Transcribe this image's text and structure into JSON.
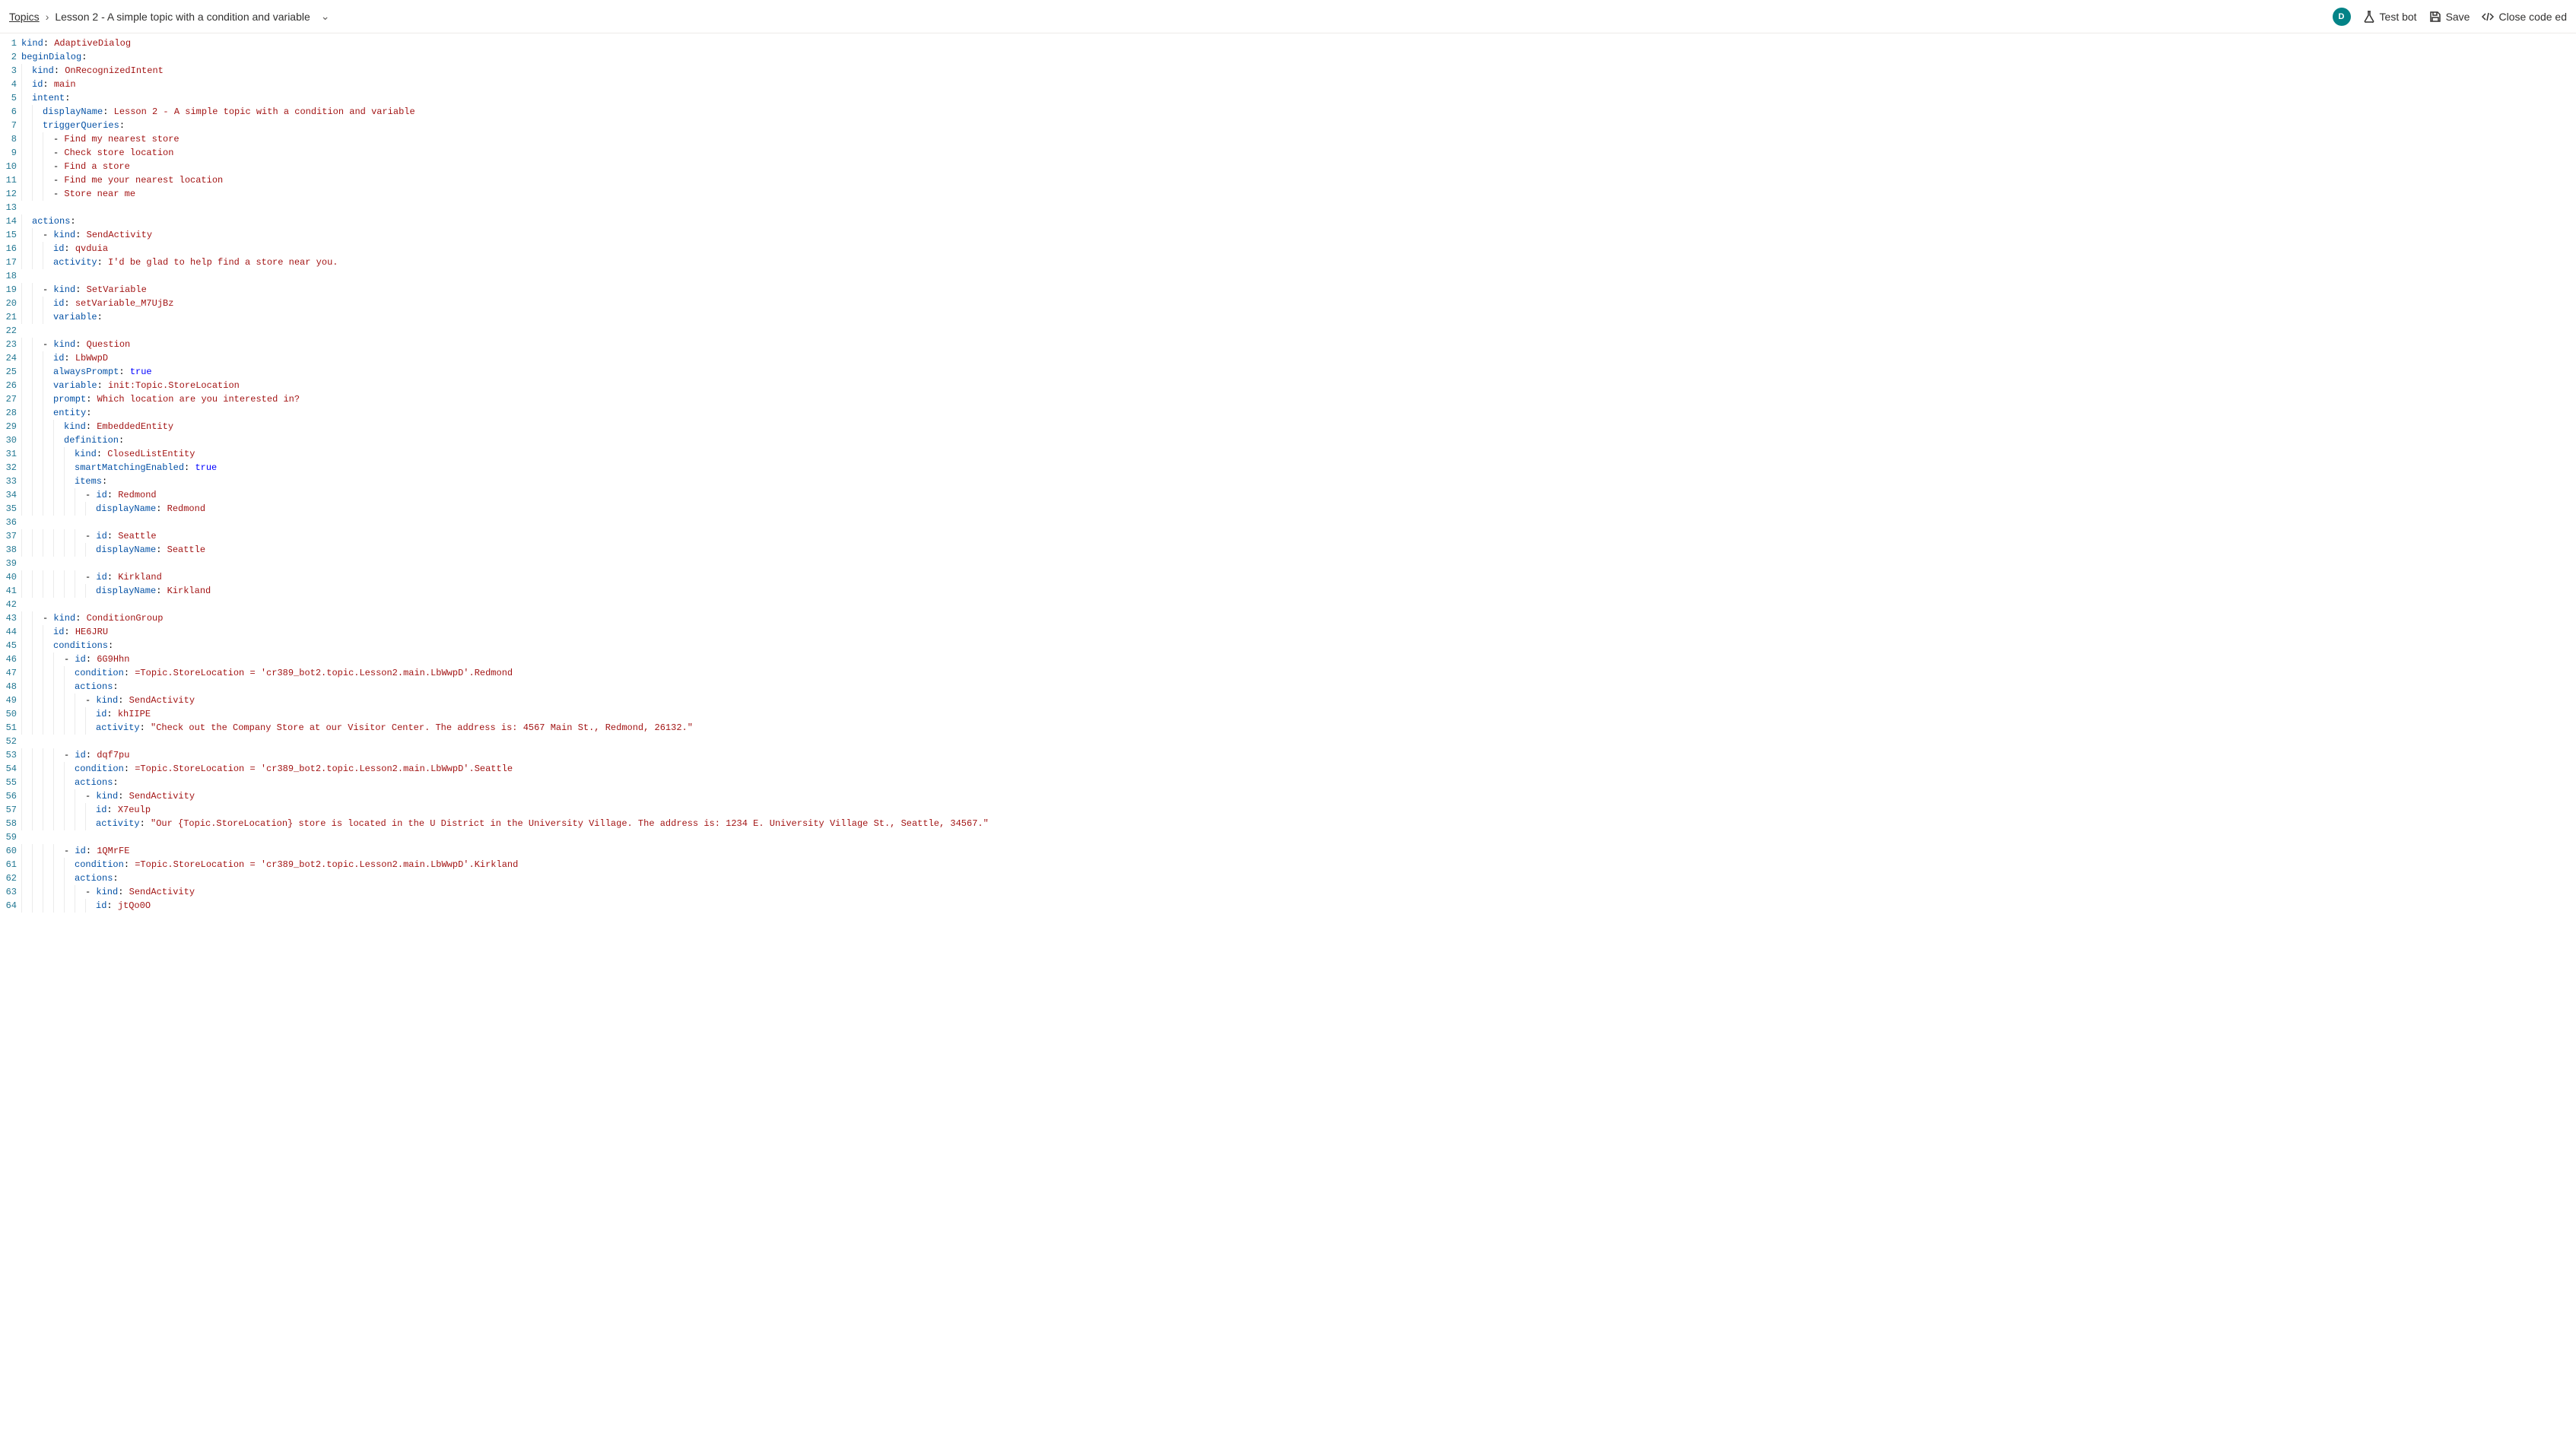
{
  "header": {
    "breadcrumb_root": "Topics",
    "breadcrumb_title": "Lesson 2 - A simple topic with a condition and variable",
    "avatar_letter": "D",
    "test_bot": "Test bot",
    "save": "Save",
    "close_code": "Close code ed"
  },
  "code": {
    "lines": [
      {
        "indent": 0,
        "segs": [
          [
            "key",
            "kind"
          ],
          [
            "punct",
            ": "
          ],
          [
            "str",
            "AdaptiveDialog"
          ]
        ]
      },
      {
        "indent": 0,
        "segs": [
          [
            "key",
            "beginDialog"
          ],
          [
            "punct",
            ":"
          ]
        ]
      },
      {
        "indent": 1,
        "segs": [
          [
            "key",
            "kind"
          ],
          [
            "punct",
            ": "
          ],
          [
            "str",
            "OnRecognizedIntent"
          ]
        ]
      },
      {
        "indent": 1,
        "segs": [
          [
            "key",
            "id"
          ],
          [
            "punct",
            ": "
          ],
          [
            "str",
            "main"
          ]
        ]
      },
      {
        "indent": 1,
        "segs": [
          [
            "key",
            "intent"
          ],
          [
            "punct",
            ":"
          ]
        ]
      },
      {
        "indent": 2,
        "segs": [
          [
            "key",
            "displayName"
          ],
          [
            "punct",
            ": "
          ],
          [
            "str",
            "Lesson 2 - A simple topic with a condition and variable"
          ]
        ]
      },
      {
        "indent": 2,
        "segs": [
          [
            "key",
            "triggerQueries"
          ],
          [
            "punct",
            ":"
          ]
        ]
      },
      {
        "indent": 3,
        "segs": [
          [
            "punct",
            "- "
          ],
          [
            "str",
            "Find my nearest store"
          ]
        ]
      },
      {
        "indent": 3,
        "segs": [
          [
            "punct",
            "- "
          ],
          [
            "str",
            "Check store location"
          ]
        ]
      },
      {
        "indent": 3,
        "segs": [
          [
            "punct",
            "- "
          ],
          [
            "str",
            "Find a store"
          ]
        ]
      },
      {
        "indent": 3,
        "segs": [
          [
            "punct",
            "- "
          ],
          [
            "str",
            "Find me your nearest location"
          ]
        ]
      },
      {
        "indent": 3,
        "segs": [
          [
            "punct",
            "- "
          ],
          [
            "str",
            "Store near me"
          ]
        ]
      },
      {
        "indent": 0,
        "segs": []
      },
      {
        "indent": 1,
        "segs": [
          [
            "key",
            "actions"
          ],
          [
            "punct",
            ":"
          ]
        ]
      },
      {
        "indent": 2,
        "segs": [
          [
            "punct",
            "- "
          ],
          [
            "key",
            "kind"
          ],
          [
            "punct",
            ": "
          ],
          [
            "str",
            "SendActivity"
          ]
        ]
      },
      {
        "indent": 3,
        "segs": [
          [
            "key",
            "id"
          ],
          [
            "punct",
            ": "
          ],
          [
            "str",
            "qvduia"
          ]
        ]
      },
      {
        "indent": 3,
        "segs": [
          [
            "key",
            "activity"
          ],
          [
            "punct",
            ": "
          ],
          [
            "str",
            "I'd be glad to help find a store near you."
          ]
        ]
      },
      {
        "indent": 0,
        "segs": []
      },
      {
        "indent": 2,
        "segs": [
          [
            "punct",
            "- "
          ],
          [
            "key",
            "kind"
          ],
          [
            "punct",
            ": "
          ],
          [
            "str",
            "SetVariable"
          ]
        ]
      },
      {
        "indent": 3,
        "segs": [
          [
            "key",
            "id"
          ],
          [
            "punct",
            ": "
          ],
          [
            "str",
            "setVariable_M7UjBz"
          ]
        ]
      },
      {
        "indent": 3,
        "segs": [
          [
            "key",
            "variable"
          ],
          [
            "punct",
            ":"
          ]
        ]
      },
      {
        "indent": 0,
        "segs": []
      },
      {
        "indent": 2,
        "segs": [
          [
            "punct",
            "- "
          ],
          [
            "key",
            "kind"
          ],
          [
            "punct",
            ": "
          ],
          [
            "str",
            "Question"
          ]
        ]
      },
      {
        "indent": 3,
        "segs": [
          [
            "key",
            "id"
          ],
          [
            "punct",
            ": "
          ],
          [
            "str",
            "LbWwpD"
          ]
        ]
      },
      {
        "indent": 3,
        "segs": [
          [
            "key",
            "alwaysPrompt"
          ],
          [
            "punct",
            ": "
          ],
          [
            "bool",
            "true"
          ]
        ]
      },
      {
        "indent": 3,
        "segs": [
          [
            "key",
            "variable"
          ],
          [
            "punct",
            ": "
          ],
          [
            "str",
            "init:Topic.StoreLocation"
          ]
        ]
      },
      {
        "indent": 3,
        "segs": [
          [
            "key",
            "prompt"
          ],
          [
            "punct",
            ": "
          ],
          [
            "str",
            "Which location are you interested in?"
          ]
        ]
      },
      {
        "indent": 3,
        "segs": [
          [
            "key",
            "entity"
          ],
          [
            "punct",
            ":"
          ]
        ]
      },
      {
        "indent": 4,
        "segs": [
          [
            "key",
            "kind"
          ],
          [
            "punct",
            ": "
          ],
          [
            "str",
            "EmbeddedEntity"
          ]
        ]
      },
      {
        "indent": 4,
        "segs": [
          [
            "key",
            "definition"
          ],
          [
            "punct",
            ":"
          ]
        ]
      },
      {
        "indent": 5,
        "segs": [
          [
            "key",
            "kind"
          ],
          [
            "punct",
            ": "
          ],
          [
            "str",
            "ClosedListEntity"
          ]
        ]
      },
      {
        "indent": 5,
        "segs": [
          [
            "key",
            "smartMatchingEnabled"
          ],
          [
            "punct",
            ": "
          ],
          [
            "bool",
            "true"
          ]
        ]
      },
      {
        "indent": 5,
        "segs": [
          [
            "key",
            "items"
          ],
          [
            "punct",
            ":"
          ]
        ]
      },
      {
        "indent": 6,
        "segs": [
          [
            "punct",
            "- "
          ],
          [
            "key",
            "id"
          ],
          [
            "punct",
            ": "
          ],
          [
            "str",
            "Redmond"
          ]
        ]
      },
      {
        "indent": 7,
        "segs": [
          [
            "key",
            "displayName"
          ],
          [
            "punct",
            ": "
          ],
          [
            "str",
            "Redmond"
          ]
        ]
      },
      {
        "indent": 0,
        "segs": []
      },
      {
        "indent": 6,
        "segs": [
          [
            "punct",
            "- "
          ],
          [
            "key",
            "id"
          ],
          [
            "punct",
            ": "
          ],
          [
            "str",
            "Seattle"
          ]
        ]
      },
      {
        "indent": 7,
        "segs": [
          [
            "key",
            "displayName"
          ],
          [
            "punct",
            ": "
          ],
          [
            "str",
            "Seattle"
          ]
        ]
      },
      {
        "indent": 0,
        "segs": []
      },
      {
        "indent": 6,
        "segs": [
          [
            "punct",
            "- "
          ],
          [
            "key",
            "id"
          ],
          [
            "punct",
            ": "
          ],
          [
            "str",
            "Kirkland"
          ]
        ]
      },
      {
        "indent": 7,
        "segs": [
          [
            "key",
            "displayName"
          ],
          [
            "punct",
            ": "
          ],
          [
            "str",
            "Kirkland"
          ]
        ]
      },
      {
        "indent": 0,
        "segs": []
      },
      {
        "indent": 2,
        "segs": [
          [
            "punct",
            "- "
          ],
          [
            "key",
            "kind"
          ],
          [
            "punct",
            ": "
          ],
          [
            "str",
            "ConditionGroup"
          ]
        ]
      },
      {
        "indent": 3,
        "segs": [
          [
            "key",
            "id"
          ],
          [
            "punct",
            ": "
          ],
          [
            "str",
            "HE6JRU"
          ]
        ]
      },
      {
        "indent": 3,
        "segs": [
          [
            "key",
            "conditions"
          ],
          [
            "punct",
            ":"
          ]
        ]
      },
      {
        "indent": 4,
        "segs": [
          [
            "punct",
            "- "
          ],
          [
            "key",
            "id"
          ],
          [
            "punct",
            ": "
          ],
          [
            "str",
            "6G9Hhn"
          ]
        ]
      },
      {
        "indent": 5,
        "segs": [
          [
            "key",
            "condition"
          ],
          [
            "punct",
            ": "
          ],
          [
            "str",
            "=Topic.StoreLocation = 'cr389_bot2.topic.Lesson2.main.LbWwpD'.Redmond"
          ]
        ]
      },
      {
        "indent": 5,
        "segs": [
          [
            "key",
            "actions"
          ],
          [
            "punct",
            ":"
          ]
        ]
      },
      {
        "indent": 6,
        "segs": [
          [
            "punct",
            "- "
          ],
          [
            "key",
            "kind"
          ],
          [
            "punct",
            ": "
          ],
          [
            "str",
            "SendActivity"
          ]
        ]
      },
      {
        "indent": 7,
        "segs": [
          [
            "key",
            "id"
          ],
          [
            "punct",
            ": "
          ],
          [
            "str",
            "khIIPE"
          ]
        ]
      },
      {
        "indent": 7,
        "segs": [
          [
            "key",
            "activity"
          ],
          [
            "punct",
            ": "
          ],
          [
            "str",
            "\"Check out the Company Store at our Visitor Center. The address is: 4567 Main St., Redmond, 26132.\""
          ]
        ]
      },
      {
        "indent": 0,
        "segs": []
      },
      {
        "indent": 4,
        "segs": [
          [
            "punct",
            "- "
          ],
          [
            "key",
            "id"
          ],
          [
            "punct",
            ": "
          ],
          [
            "str",
            "dqf7pu"
          ]
        ]
      },
      {
        "indent": 5,
        "segs": [
          [
            "key",
            "condition"
          ],
          [
            "punct",
            ": "
          ],
          [
            "str",
            "=Topic.StoreLocation = 'cr389_bot2.topic.Lesson2.main.LbWwpD'.Seattle"
          ]
        ]
      },
      {
        "indent": 5,
        "segs": [
          [
            "key",
            "actions"
          ],
          [
            "punct",
            ":"
          ]
        ]
      },
      {
        "indent": 6,
        "segs": [
          [
            "punct",
            "- "
          ],
          [
            "key",
            "kind"
          ],
          [
            "punct",
            ": "
          ],
          [
            "str",
            "SendActivity"
          ]
        ]
      },
      {
        "indent": 7,
        "segs": [
          [
            "key",
            "id"
          ],
          [
            "punct",
            ": "
          ],
          [
            "str",
            "X7eulp"
          ]
        ]
      },
      {
        "indent": 7,
        "segs": [
          [
            "key",
            "activity"
          ],
          [
            "punct",
            ": "
          ],
          [
            "str",
            "\"Our {Topic.StoreLocation} store is located in the U District in the University Village. The address is: 1234 E. University Village St., Seattle, 34567.\""
          ]
        ]
      },
      {
        "indent": 0,
        "segs": []
      },
      {
        "indent": 4,
        "segs": [
          [
            "punct",
            "- "
          ],
          [
            "key",
            "id"
          ],
          [
            "punct",
            ": "
          ],
          [
            "str",
            "1QMrFE"
          ]
        ]
      },
      {
        "indent": 5,
        "segs": [
          [
            "key",
            "condition"
          ],
          [
            "punct",
            ": "
          ],
          [
            "str",
            "=Topic.StoreLocation = 'cr389_bot2.topic.Lesson2.main.LbWwpD'.Kirkland"
          ]
        ]
      },
      {
        "indent": 5,
        "segs": [
          [
            "key",
            "actions"
          ],
          [
            "punct",
            ":"
          ]
        ]
      },
      {
        "indent": 6,
        "segs": [
          [
            "punct",
            "- "
          ],
          [
            "key",
            "kind"
          ],
          [
            "punct",
            ": "
          ],
          [
            "str",
            "SendActivity"
          ]
        ]
      },
      {
        "indent": 7,
        "segs": [
          [
            "key",
            "id"
          ],
          [
            "punct",
            ": "
          ],
          [
            "str",
            "jtQo0O"
          ]
        ]
      }
    ]
  }
}
